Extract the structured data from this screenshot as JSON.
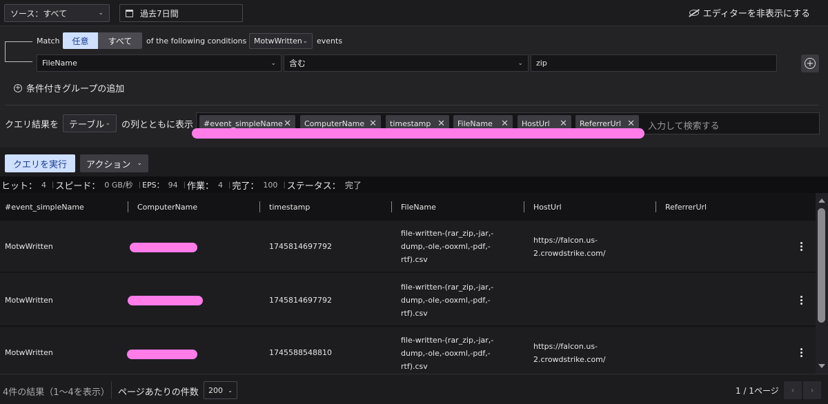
{
  "topbar": {
    "source_select": "ソース：すべて",
    "date_range": "過去7日間",
    "hide_editor": "エディターを非表示にする"
  },
  "editor": {
    "match_label": "Match",
    "match_any": "任意",
    "match_all": "すべて",
    "conditions_text": "of the following conditions in",
    "event_select": "MotwWritten",
    "events_label": "events",
    "condition": {
      "field": "FileName",
      "operator": "含む",
      "value": "zip"
    },
    "add_group": "条件付きグループの追加",
    "show_prefix": "クエリ結果を",
    "view_select": "テーブル",
    "show_suffix": "の列とともに表示",
    "column_tags": [
      "#event_simpleName",
      "ComputerName",
      "timestamp",
      "FileName",
      "HostUrl",
      "ReferrerUrl"
    ],
    "tag_search_placeholder": "入力して検索する"
  },
  "toolbar": {
    "run_query": "クエリを実行",
    "actions": "アクション"
  },
  "stats": {
    "hits_label": "ヒット：",
    "hits": "4",
    "speed_label": "スピード：",
    "speed": "0 GB/秒",
    "eps_label": "EPS：",
    "eps": "94",
    "work_label": "作業：",
    "work": "4",
    "done_label": "完了：",
    "done": "100",
    "status_label": "ステータス：",
    "status": "完了"
  },
  "table": {
    "headers": [
      "#event_simpleName",
      "ComputerName",
      "timestamp",
      "FileName",
      "HostUrl",
      "ReferrerUrl"
    ],
    "rows": [
      {
        "event": "MotwWritten",
        "timestamp": "1745814697792",
        "filename": [
          "file-written-(rar_zip,-jar,-",
          "dump,-ole,-ooxml,-pdf,-",
          "rtf).csv"
        ],
        "hosturl": [
          "https://falcon.us-",
          "2.crowdstrike.com/"
        ],
        "referrer": ""
      },
      {
        "event": "MotwWritten",
        "timestamp": "1745814697792",
        "filename": [
          "file-written-(rar_zip,-jar,-",
          "dump,-ole,-ooxml,-pdf,-",
          "rtf).csv"
        ],
        "hosturl": [
          "",
          ""
        ],
        "referrer": ""
      },
      {
        "event": "MotwWritten",
        "timestamp": "1745588548810",
        "filename": [
          "file-written-(rar_zip,-jar,-",
          "dump,-ole,-ooxml,-pdf,-",
          "rtf).csv"
        ],
        "hosturl": [
          "https://falcon.us-",
          "2.crowdstrike.com/"
        ],
        "referrer": ""
      }
    ]
  },
  "footer": {
    "result_count": "4件の結果（1〜4を表示）",
    "per_page_label": "ページあたりの件数",
    "per_page": "200",
    "page_info": "1 / 1ページ"
  },
  "colors": {
    "accent_button": "#cfe0ff",
    "redaction": "#ff7ce9"
  }
}
